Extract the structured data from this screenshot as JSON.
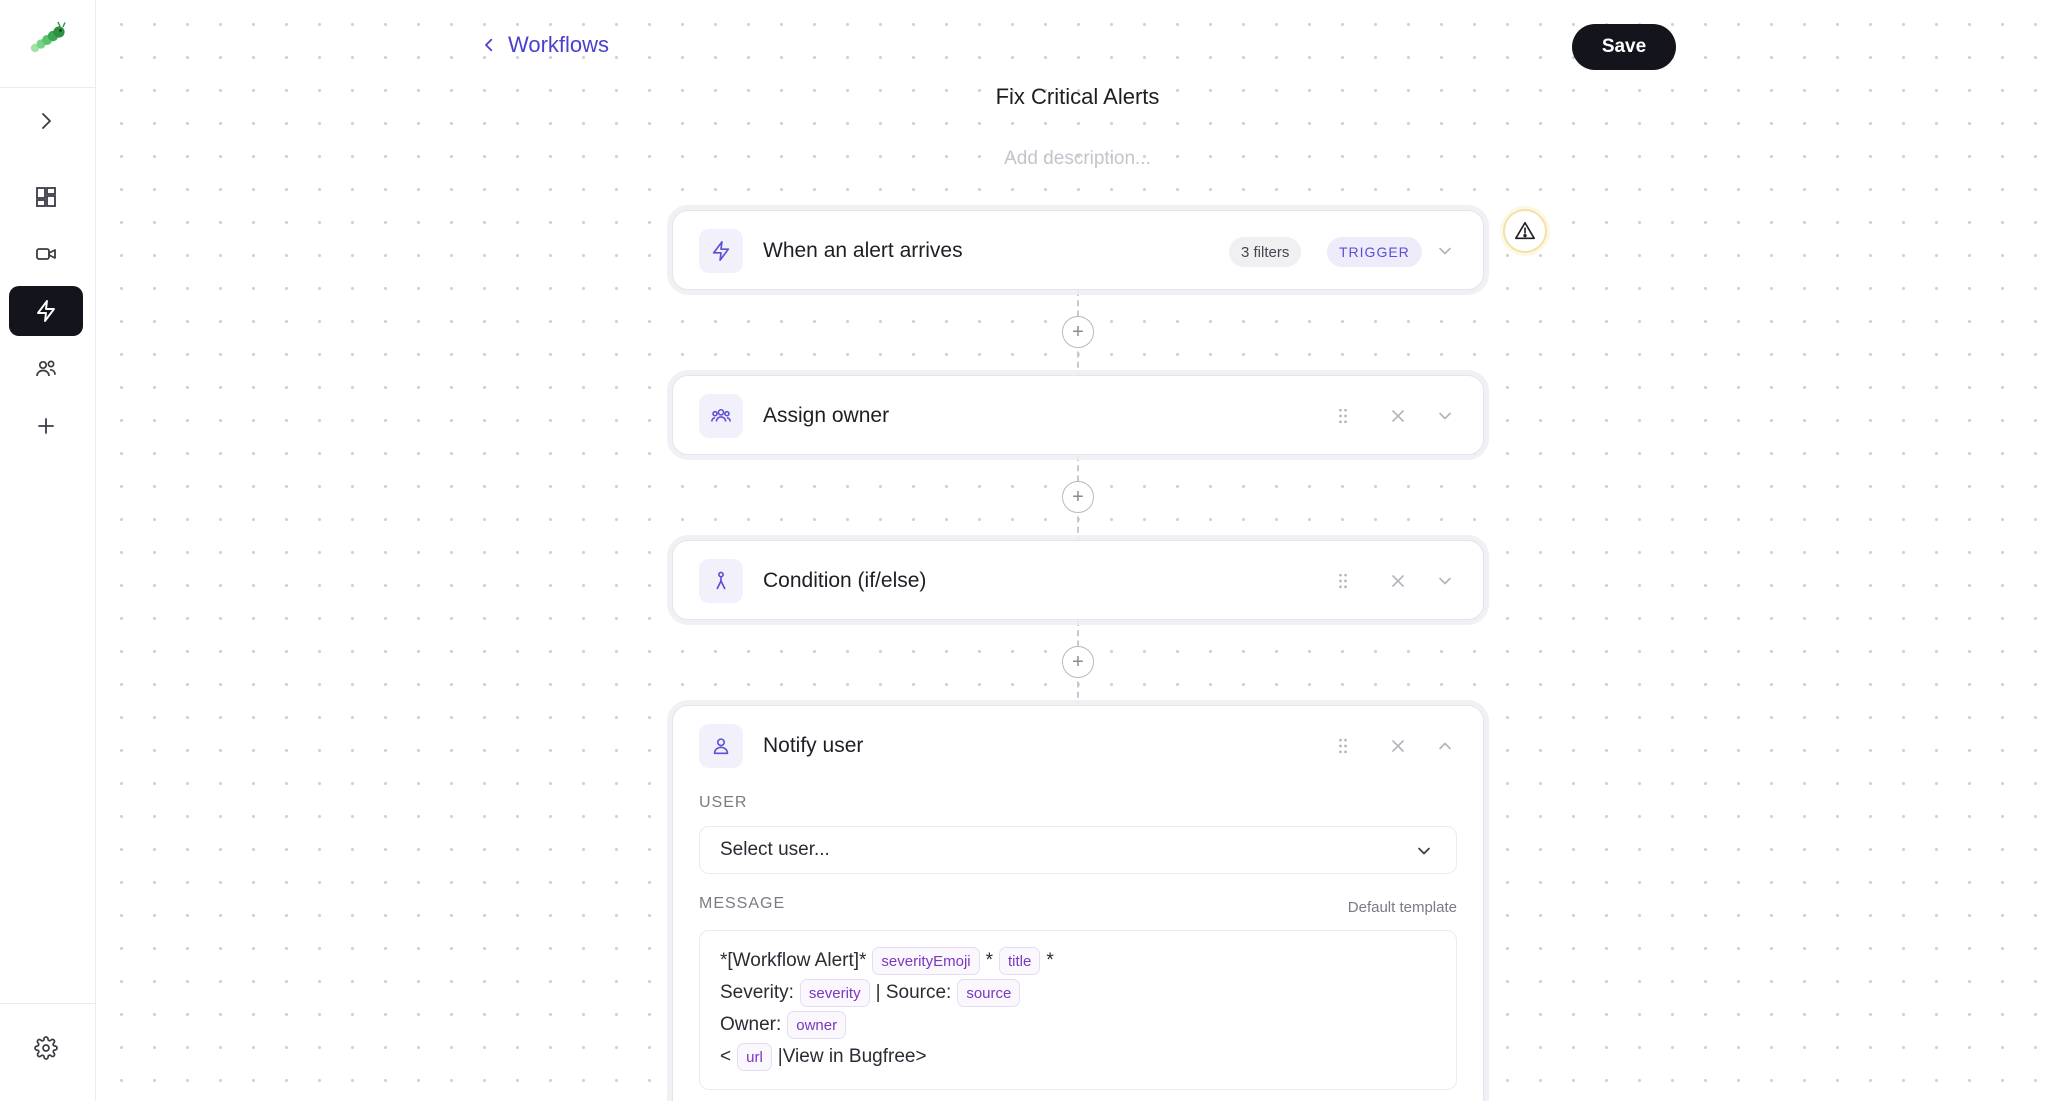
{
  "nav": {
    "back_label": "Workflows",
    "save_label": "Save"
  },
  "workflow": {
    "title": "Fix Critical Alerts",
    "description_placeholder": "Add description..."
  },
  "steps": [
    {
      "title": "When an alert arrives",
      "filters": "3 filters",
      "badge": "TRIGGER",
      "icon": "lightning-icon"
    },
    {
      "title": "Assign owner",
      "icon": "users-icon"
    },
    {
      "title": "Condition (if/else)",
      "icon": "branch-icon"
    },
    {
      "title": "Notify user",
      "icon": "user-icon",
      "user_label": "USER",
      "user_placeholder": "Select user...",
      "message_label": "MESSAGE",
      "default_template": "Default template",
      "message": {
        "line1_prefix": "*[Workflow Alert]*",
        "line1_var1": "severityEmoji",
        "line1_mid": "*",
        "line1_var2": "title",
        "line1_suffix": "*",
        "line2_prefix": "Severity:",
        "line2_var1": "severity",
        "line2_mid": "| Source:",
        "line2_var2": "source",
        "line3_prefix": "Owner:",
        "line3_var1": "owner",
        "line4_prefix": "<",
        "line4_var1": "url",
        "line4_suffix": "|View in Bugfree>"
      }
    }
  ],
  "colors": {
    "accent": "#5b4fd6",
    "dark": "#14141c",
    "chip_text": "#7a37c0",
    "warning_ring": "#f2e2a8"
  }
}
